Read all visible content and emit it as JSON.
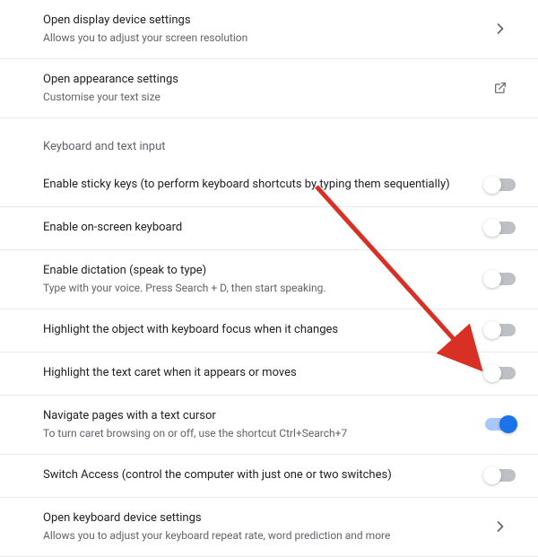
{
  "top_rows": [
    {
      "name": "open-display-settings",
      "title": "Open display device settings",
      "subtitle": "Allows you to adjust your screen resolution",
      "trailing": "chevron"
    },
    {
      "name": "open-appearance-settings",
      "title": "Open appearance settings",
      "subtitle": "Customise your text size",
      "trailing": "external"
    }
  ],
  "section_header": "Keyboard and text input",
  "keyboard_rows": [
    {
      "name": "enable-sticky-keys",
      "title": "Enable sticky keys (to perform keyboard shortcuts by typing them sequentially)",
      "subtitle": "",
      "toggle": false
    },
    {
      "name": "enable-onscreen-keyboard",
      "title": "Enable on-screen keyboard",
      "subtitle": "",
      "toggle": false
    },
    {
      "name": "enable-dictation",
      "title": "Enable dictation (speak to type)",
      "subtitle": "Type with your voice. Press Search + D, then start speaking.",
      "toggle": false
    },
    {
      "name": "highlight-keyboard-focus",
      "title": "Highlight the object with keyboard focus when it changes",
      "subtitle": "",
      "toggle": false
    },
    {
      "name": "highlight-text-caret",
      "title": "Highlight the text caret when it appears or moves",
      "subtitle": "",
      "toggle": false
    },
    {
      "name": "navigate-text-cursor",
      "title": "Navigate pages with a text cursor",
      "subtitle": "To turn caret browsing on or off, use the shortcut Ctrl+Search+7",
      "toggle": true
    },
    {
      "name": "switch-access",
      "title": "Switch Access (control the computer with just one or two switches)",
      "subtitle": "",
      "toggle": false
    },
    {
      "name": "open-keyboard-settings",
      "title": "Open keyboard device settings",
      "subtitle": "Allows you to adjust your keyboard repeat rate, word prediction and more",
      "trailing": "chevron"
    }
  ],
  "annotation_color": "#d93025"
}
